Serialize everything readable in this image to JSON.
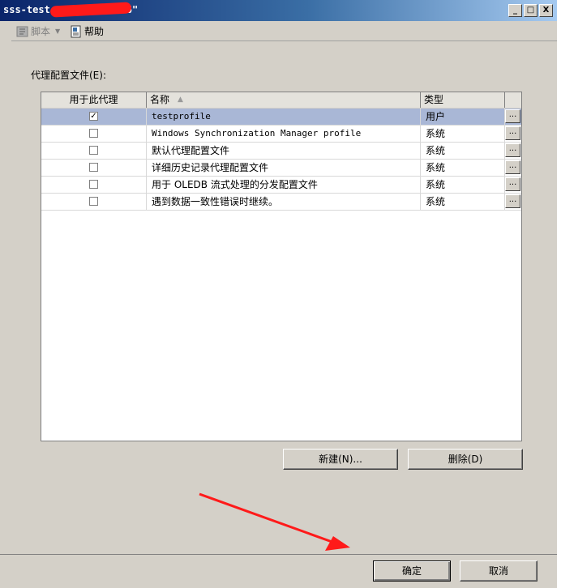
{
  "window": {
    "title": "sss-test-                  _1\\SQL08R2-6\"",
    "controls": {
      "minimize": "_",
      "maximize": "□",
      "close": "X"
    }
  },
  "toolbar": {
    "script_label": "脚本",
    "help_label": "帮助"
  },
  "section": {
    "label": "代理配置文件(E):"
  },
  "grid": {
    "columns": [
      "用于此代理",
      "名称",
      "类型"
    ],
    "rows": [
      {
        "checked": true,
        "name": "testprofile",
        "type": "用户",
        "selected": true
      },
      {
        "checked": false,
        "name": "Windows Synchronization Manager profile",
        "type": "系统"
      },
      {
        "checked": false,
        "name": "默认代理配置文件",
        "type": "系统"
      },
      {
        "checked": false,
        "name": "详细历史记录代理配置文件",
        "type": "系统"
      },
      {
        "checked": false,
        "name": "用于 OLEDB 流式处理的分发配置文件",
        "type": "系统"
      },
      {
        "checked": false,
        "name": "遇到数据一致性错误时继续。",
        "type": "系统"
      }
    ],
    "row_button": "..."
  },
  "buttons": {
    "new": "新建(N)...",
    "delete": "删除(D)",
    "ok": "确定",
    "cancel": "取消"
  },
  "colors": {
    "selection": "#a9b7d6",
    "annotation_arrow": "#ff1a1a"
  }
}
